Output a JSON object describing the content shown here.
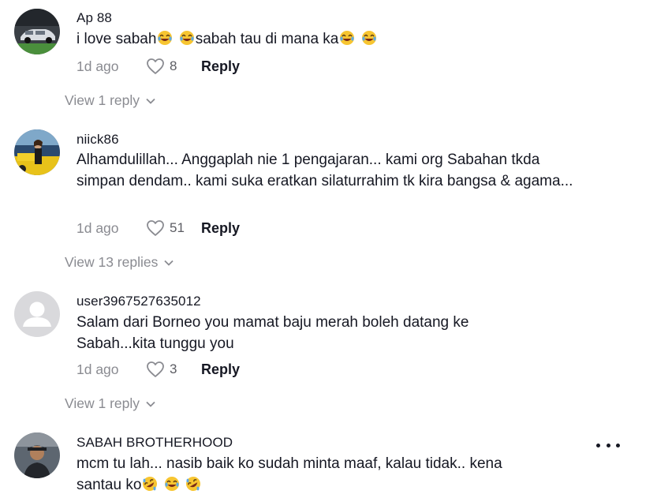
{
  "comments": [
    {
      "username": "Ap 88",
      "text": "i love sabah😂 😂sabah tau di mana ka😂 😂",
      "date": "1d ago",
      "likes": "8",
      "reply_label": "Reply",
      "view_replies": "View 1 reply",
      "avatar": "car-photo"
    },
    {
      "username": "niick86",
      "text": "Alhamdulillah... Anggaplah nie 1 pengajaran... kami org Sabahan tkda simpan dendam.. kami suka eratkan silaturrahim tk kira bangsa & agama...",
      "date": "1d ago",
      "likes": "51",
      "reply_label": "Reply",
      "view_replies": "View 13 replies",
      "avatar": "person-with-yellow-car"
    },
    {
      "username": "user3967527635012",
      "text": "Salam dari Borneo you mamat baju merah boleh datang ke Sabah...kita tunggu you",
      "date": "1d ago",
      "likes": "3",
      "reply_label": "Reply",
      "view_replies": "View 1 reply",
      "avatar": "default-avatar"
    },
    {
      "username": "SABAH BROTHERHOOD",
      "text": "mcm tu lah... nasib baik ko sudah minta maaf, kalau tidak.. kena santau ko🤣 😂 🤣",
      "avatar": "person-in-hat"
    }
  ],
  "icons": {
    "like": "heart-outline-icon",
    "expand": "chevron-down-icon",
    "more": "more-horizontal-icon"
  }
}
